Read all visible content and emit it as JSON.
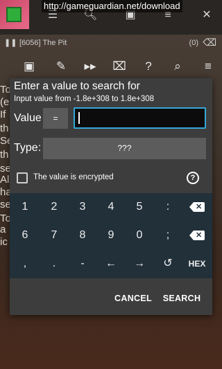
{
  "background": {
    "url_overlay": "http://gameguardian.net/download",
    "process": {
      "name": "[6056] The Pit",
      "count": "(0)"
    },
    "text_lines": [
      "To",
      "(e",
      "If",
      "th",
      "Se",
      "th",
      "se",
      "Al",
      "ha",
      "se",
      "To",
      "a",
      "ic"
    ]
  },
  "dialog": {
    "title": "Enter a value to search for",
    "subtitle": "Input value from -1.8e+308 to 1.8e+308",
    "value_label": "Value",
    "equals_button": "=",
    "value_input": "",
    "type_label": "Type:",
    "type_value": "???",
    "encrypted_label": "The value is encrypted",
    "encrypted_checked": false,
    "help_glyph": "?",
    "keypad": {
      "row1": [
        "1",
        "2",
        "3",
        "4",
        "5",
        ":"
      ],
      "row2": [
        "6",
        "7",
        "8",
        "9",
        "0",
        ";"
      ],
      "row3": [
        ",",
        ".",
        "-",
        "←",
        "→"
      ],
      "hex_label": "HEX"
    },
    "cancel_label": "CANCEL",
    "search_label": "SEARCH"
  },
  "colors": {
    "accent": "#35a8d8",
    "keypad_bg": "#22303a",
    "dialog_bg": "#3d3d3d"
  }
}
